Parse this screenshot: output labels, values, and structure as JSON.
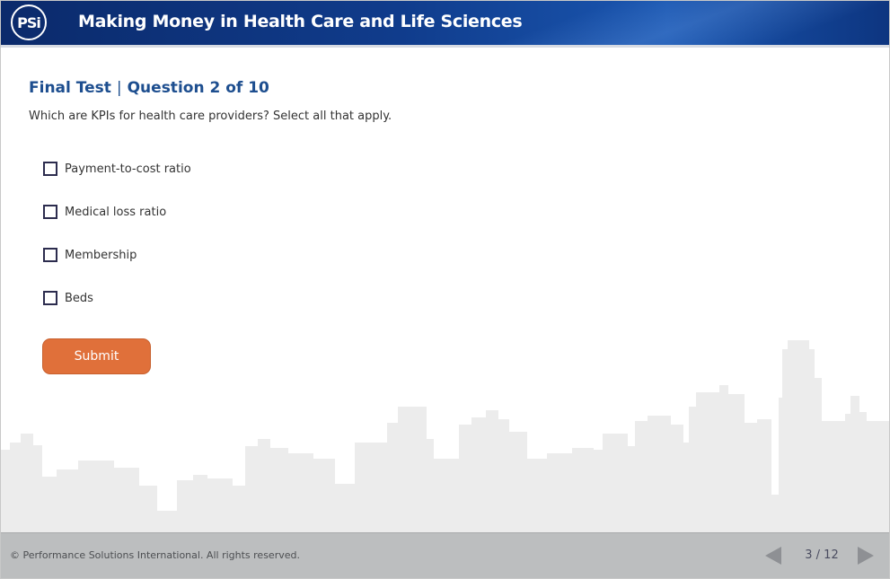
{
  "header": {
    "logo_text": "PSi",
    "title": "Making Money in Health Care and Life Sciences"
  },
  "question": {
    "section": "Final Test",
    "separator": "|",
    "number_label": "Question 2 of 10",
    "prompt": "Which are KPIs for health care providers? Select all that apply.",
    "options": [
      {
        "label": "Payment-to-cost ratio",
        "checked": false
      },
      {
        "label": "Medical loss ratio",
        "checked": false
      },
      {
        "label": "Membership",
        "checked": false
      },
      {
        "label": "Beds",
        "checked": false
      }
    ],
    "submit_label": "Submit"
  },
  "footer": {
    "copyright": "© Performance Solutions International. All rights reserved.",
    "page_indicator": "3 / 12"
  },
  "colors": {
    "header_blue": "#103c8c",
    "title_blue": "#1d4e8f",
    "submit_orange": "#e0703a",
    "footer_gray": "#bcbebf",
    "skyline_gray": "#ececec"
  },
  "icons": {
    "logo": "psi-logo",
    "prev": "triangle-left-icon",
    "next": "triangle-right-icon"
  }
}
